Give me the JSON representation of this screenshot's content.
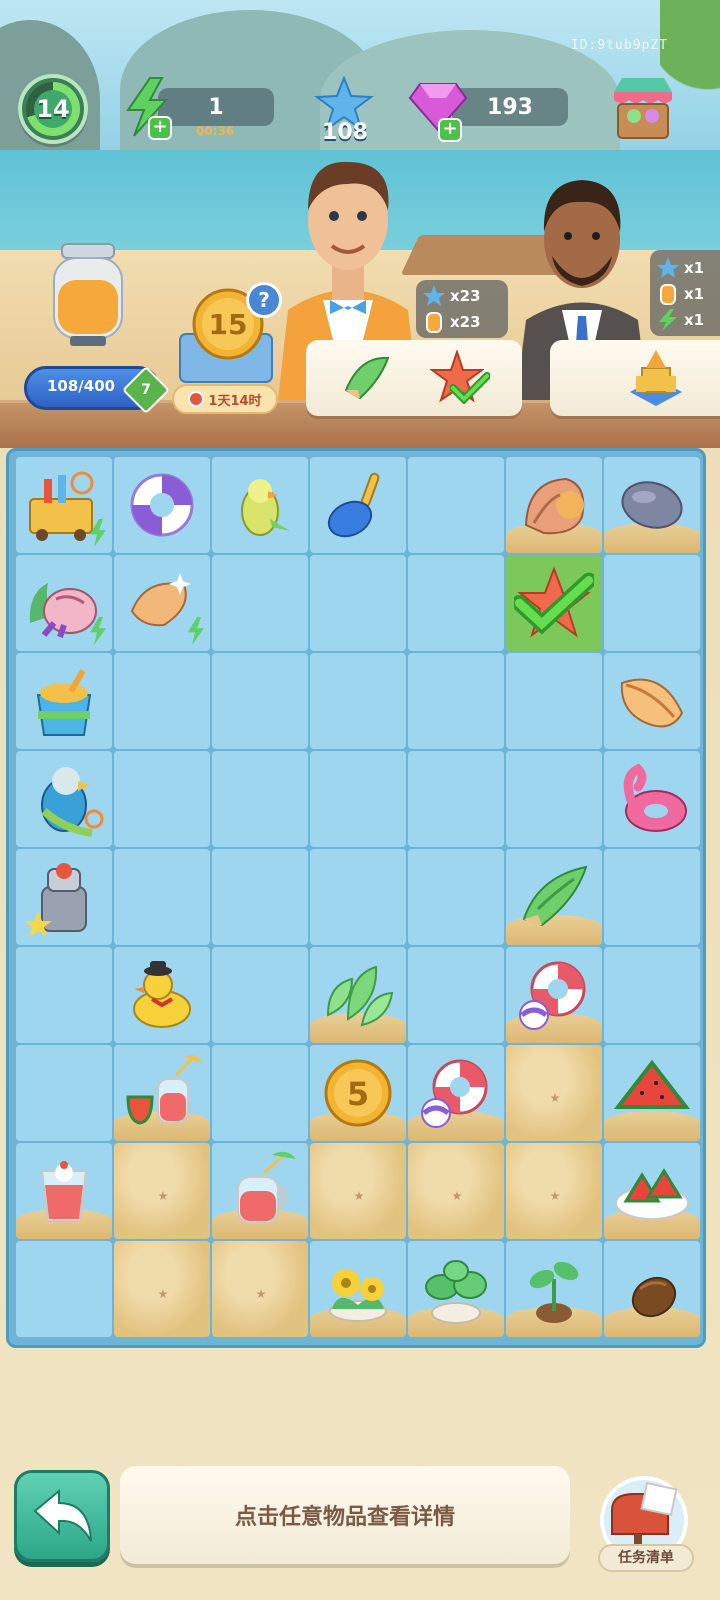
{
  "hud": {
    "player_id": "ID:9tub9pZT",
    "level": "14",
    "energy": "1",
    "energy_timer": "00:36",
    "stars": "108",
    "gems": "193"
  },
  "jar": {
    "progress_text": "108/400",
    "level": "7",
    "progress": 0.27
  },
  "offer": {
    "coin_value": "15",
    "help": "?",
    "timer": "1天14时"
  },
  "orders": [
    {
      "requirements": [
        {
          "icon": "star-icon",
          "amount": "x23"
        },
        {
          "icon": "juice-icon",
          "amount": "x23"
        }
      ],
      "items": [
        "conch-shell-icon",
        "starfish-icon"
      ],
      "completed_item": "starfish-icon"
    },
    {
      "requirements": [
        {
          "icon": "star-icon",
          "amount": "x1"
        },
        {
          "icon": "juice-icon",
          "amount": "x1"
        },
        {
          "icon": "energy-icon",
          "amount": "x1"
        }
      ],
      "items": [
        "sandcastle-icon"
      ]
    }
  ],
  "board": {
    "rows": [
      [
        "beach-cart",
        "life-ring-purple",
        "parrot-small",
        "shovel",
        "",
        "conch-shell-brown",
        "stone"
      ],
      [
        "coral-shell-pile",
        "shell-sparkle",
        "",
        "",
        "",
        "starfish-done",
        ""
      ],
      [
        "sand-bucket",
        "",
        "",
        "",
        "",
        "",
        "conch-shell-orange"
      ],
      [
        "parrot-big",
        "",
        "",
        "",
        "",
        "",
        "flamingo-float"
      ],
      [
        "juicer",
        "",
        "",
        "",
        "",
        "conch-shell-green",
        ""
      ],
      [
        "",
        "rubber-duck",
        "",
        "energy-leaves",
        "",
        "life-ring-ball",
        ""
      ],
      [
        "",
        "watermelon-juice",
        "",
        "coin-5",
        "life-ring-ball",
        "sand",
        "watermelon"
      ],
      [
        "juice-glass",
        "sand",
        "juice-jug",
        "sand",
        "sand",
        "sand",
        "watermelon-plate"
      ],
      [
        "",
        "sand",
        "sand",
        "yellow-flower",
        "plant-pot",
        "sprout",
        "seed"
      ]
    ],
    "coin_label": "5"
  },
  "bottom": {
    "hint": "点击任意物品查看详情",
    "task_list": "任务清单"
  },
  "colors": {
    "board_bg": "#6db4d6",
    "cell_bg": "#9ed6ef",
    "sand": "#e2c27f",
    "accent_green": "#4cc14a"
  }
}
